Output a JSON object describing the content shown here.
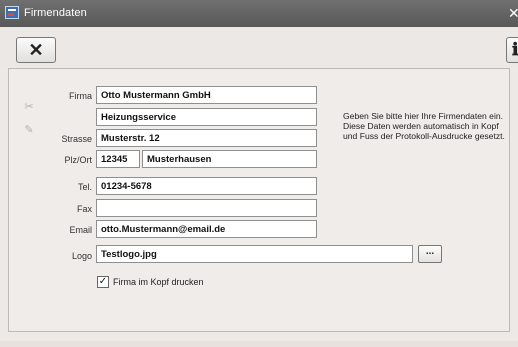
{
  "window": {
    "title": "Firmendaten",
    "close_glyph": "✕"
  },
  "toolbar": {
    "close_button_glyph": "✕",
    "info_button_glyph": "ℹ"
  },
  "form": {
    "labels": {
      "firma": "Firma",
      "strasse": "Strasse",
      "plz_ort": "Plz/Ort",
      "tel": "Tel.",
      "fax": "Fax",
      "email": "Email",
      "logo": "Logo"
    },
    "values": {
      "firma_line1": "Otto Mustermann GmbH",
      "firma_line2": "Heizungsservice",
      "strasse": "Musterstr. 12",
      "plz": "12345",
      "ort": "Musterhausen",
      "tel": "01234-5678",
      "fax": "",
      "email": "otto.Mustermann@email.de",
      "logo": "Testlogo.jpg"
    },
    "browse_button": "...",
    "checkbox": {
      "label": "Firma im Kopf drucken",
      "checked": true,
      "mark": "✓"
    }
  },
  "info_text": "Geben Sie bitte hier Ihre Firmendaten ein. Diese Daten werden automatisch in Kopf und Fuss der Protokoll-Ausdrucke gesetzt.",
  "side_tools": {
    "cut_glyph": "✂",
    "edit_glyph": "✎"
  }
}
